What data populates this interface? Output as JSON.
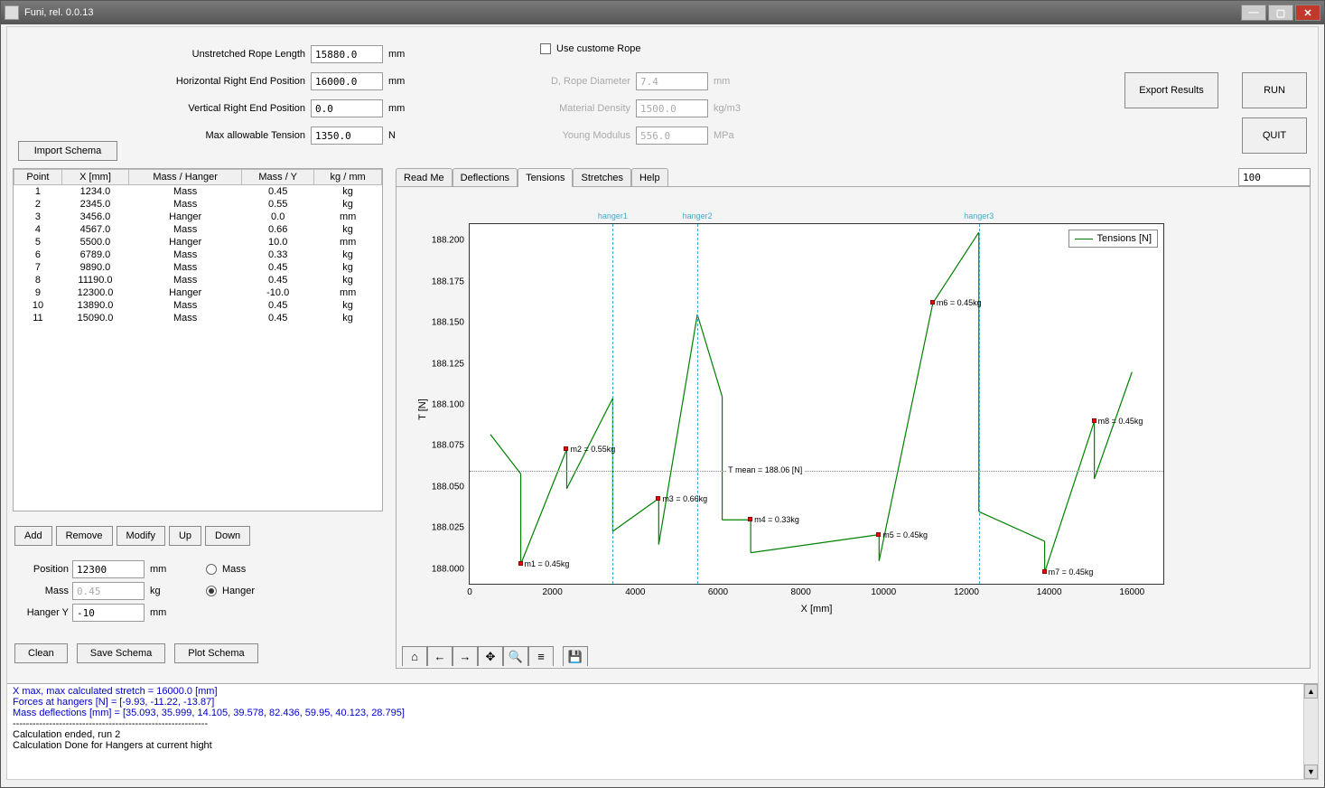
{
  "window_title": "Funi, rel. 0.0.13",
  "inputs": {
    "unstretched_label": "Unstretched Rope Length",
    "unstretched_value": "15880.0",
    "horiz_label": "Horizontal Right End Position",
    "horiz_value": "16000.0",
    "vert_label": "Vertical Right End Position",
    "vert_value": "0.0",
    "tension_label": "Max allowable Tension",
    "tension_value": "1350.0",
    "unit_mm": "mm",
    "unit_n": "N",
    "custom_rope_label": "Use custome Rope",
    "diameter_label": "D, Rope Diameter",
    "diameter_value": "7.4",
    "density_label": "Material Density",
    "density_value": "1500.0",
    "young_label": "Young Modulus",
    "young_value": "556.0",
    "unit_kgm3": "kg/m3",
    "unit_mpa": "MPa"
  },
  "buttons": {
    "import_schema": "Import Schema",
    "export_results": "Export Results",
    "run": "RUN",
    "quit": "QUIT",
    "add": "Add",
    "remove": "Remove",
    "modify": "Modify",
    "up": "Up",
    "down": "Down",
    "clean": "Clean",
    "save_schema": "Save Schema",
    "plot_schema": "Plot Schema"
  },
  "table": {
    "headers": [
      "Point",
      "X [mm]",
      "Mass / Hanger",
      "Mass / Y",
      "kg / mm"
    ],
    "rows": [
      [
        "1",
        "1234.0",
        "Mass",
        "0.45",
        "kg"
      ],
      [
        "2",
        "2345.0",
        "Mass",
        "0.55",
        "kg"
      ],
      [
        "3",
        "3456.0",
        "Hanger",
        "0.0",
        "mm"
      ],
      [
        "4",
        "4567.0",
        "Mass",
        "0.66",
        "kg"
      ],
      [
        "5",
        "5500.0",
        "Hanger",
        "10.0",
        "mm"
      ],
      [
        "6",
        "6789.0",
        "Mass",
        "0.33",
        "kg"
      ],
      [
        "7",
        "9890.0",
        "Mass",
        "0.45",
        "kg"
      ],
      [
        "8",
        "11190.0",
        "Mass",
        "0.45",
        "kg"
      ],
      [
        "9",
        "12300.0",
        "Hanger",
        "-10.0",
        "mm"
      ],
      [
        "10",
        "13890.0",
        "Mass",
        "0.45",
        "kg"
      ],
      [
        "11",
        "15090.0",
        "Mass",
        "0.45",
        "kg"
      ]
    ]
  },
  "edit": {
    "position_label": "Position",
    "position_value": "12300",
    "position_unit": "mm",
    "mass_label": "Mass",
    "mass_value": "0.45",
    "mass_unit": "kg",
    "hangery_label": "Hanger Y",
    "hangery_value": "-10",
    "hangery_unit": "mm",
    "radio_mass": "Mass",
    "radio_hanger": "Hanger"
  },
  "tabs": [
    "Read Me",
    "Deflections",
    "Tensions",
    "Stretches",
    "Help"
  ],
  "active_tab": 2,
  "zoom_value": "100",
  "console_lines": [
    {
      "text": "X max, max calculated stretch = 16000.0 [mm]",
      "cls": "blue"
    },
    {
      "text": "Forces at hangers [N] = [-9.93, -11.22, -13.87]",
      "cls": "blue"
    },
    {
      "text": "Mass deflections [mm] = [35.093, 35.999, 14.105, 39.578, 82.436, 59.95, 40.123, 28.795]",
      "cls": "blue"
    },
    {
      "text": "",
      "cls": ""
    },
    {
      "text": "-----------------------------------------------------------",
      "cls": ""
    },
    {
      "text": "Calculation ended, run 2",
      "cls": ""
    },
    {
      "text": "Calculation Done for Hangers at current hight",
      "cls": ""
    }
  ],
  "chart_data": {
    "type": "line",
    "title": "",
    "xlabel": "X  [mm]",
    "ylabel": "T [N]",
    "xlim": [
      0,
      16800
    ],
    "ylim": [
      187.99,
      188.21
    ],
    "x_ticks": [
      0,
      2000,
      4000,
      6000,
      8000,
      10000,
      12000,
      14000,
      16000
    ],
    "y_ticks": [
      188.0,
      188.025,
      188.05,
      188.075,
      188.1,
      188.125,
      188.15,
      188.175,
      188.2
    ],
    "legend": "Tensions [N]",
    "mean_line": {
      "value": 188.06,
      "label": "T mean = 188.06 [N]"
    },
    "hangers": [
      {
        "x": 3456,
        "label": "hanger1"
      },
      {
        "x": 5500,
        "label": "hanger2"
      },
      {
        "x": 12300,
        "label": "hanger3"
      }
    ],
    "mass_points": [
      {
        "x": 1234,
        "y": 188.003,
        "label": "m1 = 0.45kg"
      },
      {
        "x": 2345,
        "y": 188.073,
        "label": "m2 = 0.55kg"
      },
      {
        "x": 4567,
        "y": 188.043,
        "label": "m3 = 0.66kg"
      },
      {
        "x": 6789,
        "y": 188.03,
        "label": "m4 = 0.33kg"
      },
      {
        "x": 9890,
        "y": 188.021,
        "label": "m5 = 0.45kg"
      },
      {
        "x": 11190,
        "y": 188.162,
        "label": "m6 = 0.45kg"
      },
      {
        "x": 13890,
        "y": 187.998,
        "label": "m7 = 0.45kg"
      },
      {
        "x": 15090,
        "y": 188.09,
        "label": "m8 = 0.45kg"
      }
    ],
    "line_segments": [
      [
        [
          500,
          188.082
        ],
        [
          1234,
          188.058
        ]
      ],
      [
        [
          1234,
          188.058
        ],
        [
          1234,
          188.003
        ]
      ],
      [
        [
          1234,
          188.003
        ],
        [
          2345,
          188.073
        ]
      ],
      [
        [
          2345,
          188.073
        ],
        [
          2345,
          188.049
        ]
      ],
      [
        [
          2345,
          188.049
        ],
        [
          3456,
          188.104
        ]
      ],
      [
        [
          3456,
          188.104
        ],
        [
          3456,
          188.023
        ]
      ],
      [
        [
          3456,
          188.023
        ],
        [
          4567,
          188.043
        ]
      ],
      [
        [
          4567,
          188.043
        ],
        [
          4567,
          188.015
        ]
      ],
      [
        [
          4567,
          188.015
        ],
        [
          5500,
          188.155
        ]
      ],
      [
        [
          5500,
          188.155
        ],
        [
          6100,
          188.105
        ]
      ],
      [
        [
          6100,
          188.105
        ],
        [
          6100,
          188.03
        ]
      ],
      [
        [
          6100,
          188.03
        ],
        [
          6789,
          188.03
        ]
      ],
      [
        [
          6789,
          188.03
        ],
        [
          6789,
          188.01
        ]
      ],
      [
        [
          6789,
          188.01
        ],
        [
          9890,
          188.021
        ]
      ],
      [
        [
          9890,
          188.021
        ],
        [
          9890,
          188.005
        ]
      ],
      [
        [
          9890,
          188.005
        ],
        [
          11190,
          188.162
        ]
      ],
      [
        [
          11190,
          188.162
        ],
        [
          12300,
          188.205
        ]
      ],
      [
        [
          12300,
          188.205
        ],
        [
          12300,
          188.035
        ]
      ],
      [
        [
          12300,
          188.035
        ],
        [
          13890,
          188.017
        ]
      ],
      [
        [
          13890,
          188.017
        ],
        [
          13890,
          187.998
        ]
      ],
      [
        [
          13890,
          187.998
        ],
        [
          15090,
          188.09
        ]
      ],
      [
        [
          15090,
          188.09
        ],
        [
          15090,
          188.055
        ]
      ],
      [
        [
          15090,
          188.055
        ],
        [
          16000,
          188.12
        ]
      ]
    ]
  }
}
